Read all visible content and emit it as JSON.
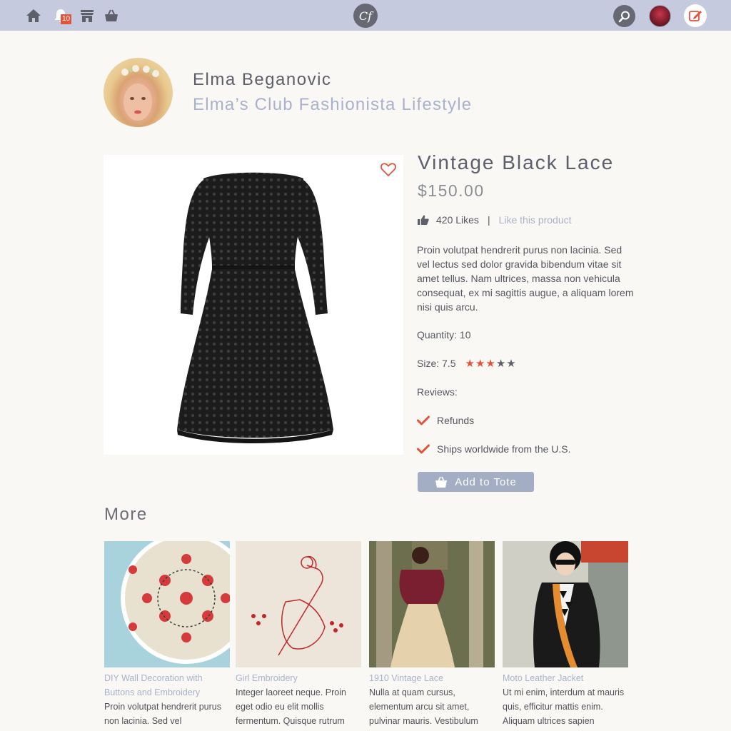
{
  "topbar": {
    "icons": [
      "home-icon",
      "bell-icon",
      "store-icon",
      "basket-icon",
      "search-icon",
      "edit-icon"
    ],
    "notification_count": "10",
    "logo_text": "Cf"
  },
  "profile": {
    "name": "Elma Beganovic",
    "club": "Elma’s Club Fashionista Lifestyle"
  },
  "product": {
    "title": "Vintage Black Lace",
    "price": "$150.00",
    "likes": "420 Likes",
    "separator": "|",
    "like_link": "Like this product",
    "description": "Proin volutpat hendrerit purus non lacinia. Sed vel lectus sed dolor gravida bibendum vitae sit amet tellus. Nam ultrices, massa non vehicula consequat, ex mi sagittis augue, a aliquam lorem nisi quis arcu.",
    "quantity": "Quantity: 10",
    "size": "Size: 7.5",
    "rating": 3,
    "rating_max": 5,
    "reviews_label": "Reviews:",
    "features": [
      "Refunds",
      "Ships worldwide from the U.S."
    ],
    "add_to_tote": "Add to Tote"
  },
  "colors": {
    "accent": "#e2533b",
    "topbar": "#c5cade",
    "button": "#a3adc4",
    "link": "#a9b2cc",
    "star_off": "#5d5f6b"
  },
  "more": {
    "heading": "More",
    "cards": [
      {
        "title": "DIY Wall Decoration with Buttons and Embroidery",
        "desc": "Proin volutpat hendrerit purus non lacinia. Sed vel"
      },
      {
        "title": "Girl Embroidery",
        "desc": "Integer laoreet neque. Proin eget odio eu elit mollis fermentum. Quisque rutrum"
      },
      {
        "title": "1910 Vintage Lace",
        "desc": "Nulla at quam cursus, elementum arcu sit amet, pulvinar mauris. Vestibulum"
      },
      {
        "title": "Moto Leather Jacket",
        "desc": "Ut mi enim, interdum at mauris quis, efficitur mattis enim. Aliquam ultrices sapien"
      }
    ]
  }
}
